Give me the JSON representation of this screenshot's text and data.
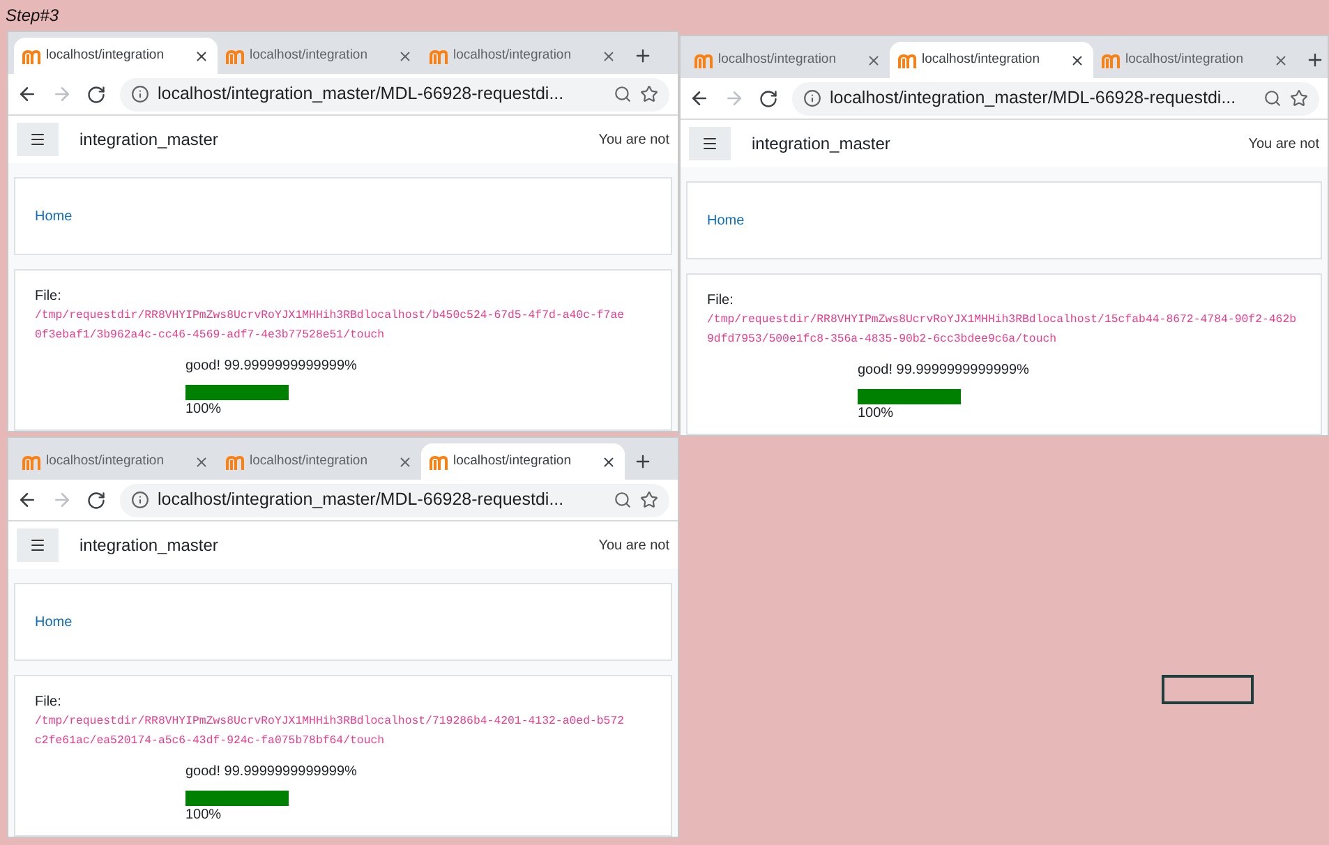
{
  "caption": "Step#3",
  "windows": [
    {
      "tabs": [
        {
          "label": "localhost/integration",
          "selected": true
        },
        {
          "label": "localhost/integration",
          "selected": false
        },
        {
          "label": "localhost/integration",
          "selected": false
        }
      ],
      "address": "localhost/integration_master/MDL-66928-requestdi...",
      "site_name": "integration_master",
      "login_text": "You are not",
      "breadcrumb": "Home",
      "file_label": "File:",
      "file_path": "/tmp/requestdir/RR8VHYIPmZws8UcrvRoYJX1MHHih3RBdlocalhost/b450c524-67d5-4f7d-a40c-f7ae0f3ebaf1/3b962a4c-cc46-4569-adf7-4e3b77528e51/touch",
      "status": "good! 99.9999999999999%",
      "progress": {
        "level": 1,
        "label": "100%"
      }
    },
    {
      "tabs": [
        {
          "label": "localhost/integration",
          "selected": false
        },
        {
          "label": "localhost/integration",
          "selected": true
        },
        {
          "label": "localhost/integration",
          "selected": false
        }
      ],
      "address": "localhost/integration_master/MDL-66928-requestdi...",
      "site_name": "integration_master",
      "login_text": "You are not",
      "breadcrumb": "Home",
      "file_label": "File:",
      "file_path": "/tmp/requestdir/RR8VHYIPmZws8UcrvRoYJX1MHHih3RBdlocalhost/15cfab44-8672-4784-90f2-462b9dfd7953/500e1fc8-356a-4835-90b2-6cc3bdee9c6a/touch",
      "status": "good! 99.9999999999999%",
      "progress": {
        "level": 1,
        "label": "100%"
      }
    },
    {
      "tabs": [
        {
          "label": "localhost/integration",
          "selected": false
        },
        {
          "label": "localhost/integration",
          "selected": false
        },
        {
          "label": "localhost/integration",
          "selected": true
        }
      ],
      "address": "localhost/integration_master/MDL-66928-requestdi...",
      "site_name": "integration_master",
      "login_text": "You are not",
      "breadcrumb": "Home",
      "file_label": "File:",
      "file_path": "/tmp/requestdir/RR8VHYIPmZws8UcrvRoYJX1MHHih3RBdlocalhost/719286b4-4201-4132-a0ed-b572c2fe61ac/ea520174-a5c6-43df-924c-fa075b78bf64/touch",
      "status": "good! 99.9999999999999%",
      "progress": {
        "level": 1,
        "label": "100%"
      }
    }
  ]
}
